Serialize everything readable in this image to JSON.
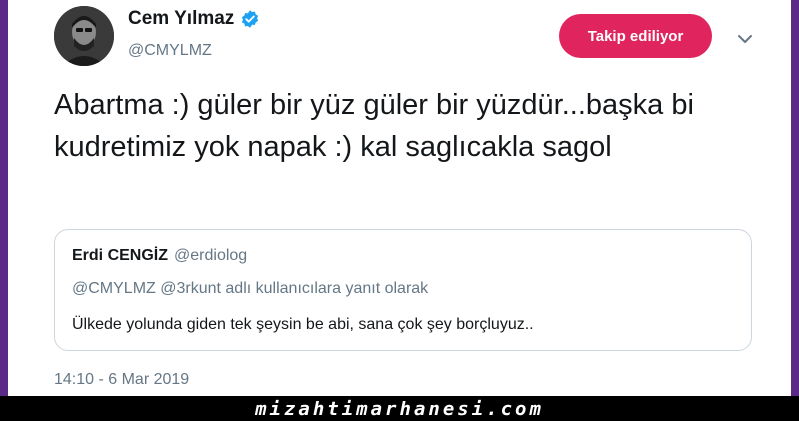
{
  "tweet": {
    "author_name": "Cem Yılmaz",
    "author_handle": "@CMYLMZ",
    "follow_label": "Takip ediliyor",
    "text": "Abartma :) güler bir yüz güler bir yüzdür...başka bi kudretimiz yok napak :) kal saglıcakla sagol",
    "timestamp": "14:10 - 6 Mar 2019"
  },
  "quote": {
    "name": "Erdi CENGİZ",
    "handle": "@erdiolog",
    "reply_context": "@CMYLMZ @3rkunt adlı kullanıcılara yanıt olarak",
    "text": "Ülkede yolunda giden tek şeysin be abi, sana çok şey borçluyuz.."
  },
  "icons": {
    "verified": "verified-badge-icon",
    "caret": "chevron-down-icon"
  },
  "colors": {
    "follow_button": "#e0245e",
    "verified": "#1da1f2",
    "frame": "#5b2a86"
  },
  "watermark": {
    "text": "mizahtimarhanesi.com"
  }
}
